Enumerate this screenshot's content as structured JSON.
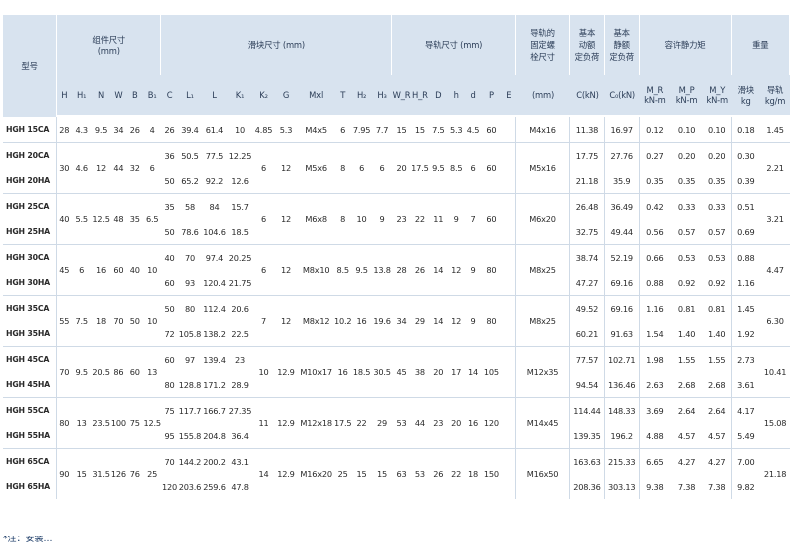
{
  "groups": {
    "model": "型号",
    "assembly": "组件尺寸\n(mm)",
    "block": "滑块尺寸 (mm)",
    "rail": "导轨尺寸 (mm)",
    "rail_bolt": "导轨的\n固定螺\n栓尺寸",
    "dyn_load": "基本\n动额\n定负荷",
    "stat_load": "基本\n静额\n定负荷",
    "moment": "容许静力矩",
    "weight": "重量"
  },
  "sub_headers": [
    "H",
    "H₁",
    "N",
    "W",
    "B",
    "B₁",
    "C",
    "L₁",
    "L",
    "K₁",
    "K₂",
    "G",
    "Mxl",
    "T",
    "H₂",
    "H₃",
    "W_R",
    "H_R",
    "D",
    "h",
    "d",
    "P",
    "E",
    "(mm)",
    "C(kN)",
    "C₀(kN)",
    "M_R\nkN-m",
    "M_P\nkN-m",
    "M_Y\nkN-m",
    "滑块\nkg",
    "导轨\nkg/m"
  ],
  "rows": [
    {
      "model": "HGH 15CA",
      "H": "28",
      "H1": "4.3",
      "N": "9.5",
      "W": "34",
      "B": "26",
      "B1": "4",
      "C": "26",
      "L1": "39.4",
      "L": "61.4",
      "K1": "10",
      "K2": "4.85",
      "G": "5.3",
      "Mxl": "M4x5",
      "T": "6",
      "H2": "7.95",
      "H3": "7.7",
      "WR": "15",
      "HR": "15",
      "D": "7.5",
      "h": "5.3",
      "d": "4.5",
      "P": "60",
      "E": "",
      "bolt": "M4x16",
      "C_kN": "11.38",
      "C0_kN": "16.97",
      "MR": "0.12",
      "MP": "0.10",
      "MY": "0.10",
      "block_kg": "0.18",
      "rail_kg": "1.45"
    },
    {
      "model": "HGH 20CA",
      "H": "30",
      "H1": "4.6",
      "N": "12",
      "W": "44",
      "B": "32",
      "B1": "6",
      "C": "36",
      "L1": "50.5",
      "L": "77.5",
      "K1": "12.25",
      "K2": "6",
      "G": "12",
      "Mxl": "M5x6",
      "T": "8",
      "H2": "6",
      "H3": "6",
      "WR": "20",
      "HR": "17.5",
      "D": "9.5",
      "h": "8.5",
      "d": "6",
      "P": "60",
      "E": "",
      "bolt": "M5x16",
      "C_kN": "17.75",
      "C0_kN": "27.76",
      "MR": "0.27",
      "MP": "0.20",
      "MY": "0.20",
      "block_kg": "0.30",
      "rail_kg": "2.21"
    },
    {
      "model": "HGH 20HA",
      "C": "50",
      "L1": "65.2",
      "L": "92.2",
      "K1": "12.6",
      "C_kN": "21.18",
      "C0_kN": "35.9",
      "MR": "0.35",
      "MP": "0.35",
      "MY": "0.35",
      "block_kg": "0.39"
    },
    {
      "model": "HGH 25CA",
      "H": "40",
      "H1": "5.5",
      "N": "12.5",
      "W": "48",
      "B": "35",
      "B1": "6.5",
      "C": "35",
      "L1": "58",
      "L": "84",
      "K1": "15.7",
      "K2": "6",
      "G": "12",
      "Mxl": "M6x8",
      "T": "8",
      "H2": "10",
      "H3": "9",
      "WR": "23",
      "HR": "22",
      "D": "11",
      "h": "9",
      "d": "7",
      "P": "60",
      "E": "",
      "bolt": "M6x20",
      "C_kN": "26.48",
      "C0_kN": "36.49",
      "MR": "0.42",
      "MP": "0.33",
      "MY": "0.33",
      "block_kg": "0.51",
      "rail_kg": "3.21"
    },
    {
      "model": "HGH 25HA",
      "C": "50",
      "L1": "78.6",
      "L": "104.6",
      "K1": "18.5",
      "C_kN": "32.75",
      "C0_kN": "49.44",
      "MR": "0.56",
      "MP": "0.57",
      "MY": "0.57",
      "block_kg": "0.69"
    },
    {
      "model": "HGH 30CA",
      "H": "45",
      "H1": "6",
      "N": "16",
      "W": "60",
      "B": "40",
      "B1": "10",
      "C": "40",
      "L1": "70",
      "L": "97.4",
      "K1": "20.25",
      "K2": "6",
      "G": "12",
      "Mxl": "M8x10",
      "T": "8.5",
      "H2": "9.5",
      "H3": "13.8",
      "WR": "28",
      "HR": "26",
      "D": "14",
      "h": "12",
      "d": "9",
      "P": "80",
      "E": "",
      "bolt": "M8x25",
      "C_kN": "38.74",
      "C0_kN": "52.19",
      "MR": "0.66",
      "MP": "0.53",
      "MY": "0.53",
      "block_kg": "0.88",
      "rail_kg": "4.47"
    },
    {
      "model": "HGH 30HA",
      "C": "60",
      "L1": "93",
      "L": "120.4",
      "K1": "21.75",
      "C_kN": "47.27",
      "C0_kN": "69.16",
      "MR": "0.88",
      "MP": "0.92",
      "MY": "0.92",
      "block_kg": "1.16"
    },
    {
      "model": "HGH 35CA",
      "H": "55",
      "H1": "7.5",
      "N": "18",
      "W": "70",
      "B": "50",
      "B1": "10",
      "C": "50",
      "L1": "80",
      "L": "112.4",
      "K1": "20.6",
      "K2": "7",
      "G": "12",
      "Mxl": "M8x12",
      "T": "10.2",
      "H2": "16",
      "H3": "19.6",
      "WR": "34",
      "HR": "29",
      "D": "14",
      "h": "12",
      "d": "9",
      "P": "80",
      "E": "",
      "bolt": "M8x25",
      "C_kN": "49.52",
      "C0_kN": "69.16",
      "MR": "1.16",
      "MP": "0.81",
      "MY": "0.81",
      "block_kg": "1.45",
      "rail_kg": "6.30"
    },
    {
      "model": "HGH 35HA",
      "C": "72",
      "L1": "105.8",
      "L": "138.2",
      "K1": "22.5",
      "C_kN": "60.21",
      "C0_kN": "91.63",
      "MR": "1.54",
      "MP": "1.40",
      "MY": "1.40",
      "block_kg": "1.92"
    },
    {
      "model": "HGH 45CA",
      "H": "70",
      "H1": "9.5",
      "N": "20.5",
      "W": "86",
      "B": "60",
      "B1": "13",
      "C": "60",
      "L1": "97",
      "L": "139.4",
      "K1": "23",
      "K2": "10",
      "G": "12.9",
      "Mxl": "M10x17",
      "T": "16",
      "H2": "18.5",
      "H3": "30.5",
      "WR": "45",
      "HR": "38",
      "D": "20",
      "h": "17",
      "d": "14",
      "P": "105",
      "E": "",
      "bolt": "M12x35",
      "C_kN": "77.57",
      "C0_kN": "102.71",
      "MR": "1.98",
      "MP": "1.55",
      "MY": "1.55",
      "block_kg": "2.73",
      "rail_kg": "10.41"
    },
    {
      "model": "HGH 45HA",
      "C": "80",
      "L1": "128.8",
      "L": "171.2",
      "K1": "28.9",
      "C_kN": "94.54",
      "C0_kN": "136.46",
      "MR": "2.63",
      "MP": "2.68",
      "MY": "2.68",
      "block_kg": "3.61"
    },
    {
      "model": "HGH 55CA",
      "H": "80",
      "H1": "13",
      "N": "23.5",
      "W": "100",
      "B": "75",
      "B1": "12.5",
      "C": "75",
      "L1": "117.7",
      "L": "166.7",
      "K1": "27.35",
      "K2": "11",
      "G": "12.9",
      "Mxl": "M12x18",
      "T": "17.5",
      "H2": "22",
      "H3": "29",
      "WR": "53",
      "HR": "44",
      "D": "23",
      "h": "20",
      "d": "16",
      "P": "120",
      "E": "",
      "bolt": "M14x45",
      "C_kN": "114.44",
      "C0_kN": "148.33",
      "MR": "3.69",
      "MP": "2.64",
      "MY": "2.64",
      "block_kg": "4.17",
      "rail_kg": "15.08"
    },
    {
      "model": "HGH 55HA",
      "C": "95",
      "L1": "155.8",
      "L": "204.8",
      "K1": "36.4",
      "C_kN": "139.35",
      "C0_kN": "196.2",
      "MR": "4.88",
      "MP": "4.57",
      "MY": "4.57",
      "block_kg": "5.49"
    },
    {
      "model": "HGH 65CA",
      "H": "90",
      "H1": "15",
      "N": "31.5",
      "W": "126",
      "B": "76",
      "B1": "25",
      "C": "70",
      "L1": "144.2",
      "L": "200.2",
      "K1": "43.1",
      "K2": "14",
      "G": "12.9",
      "Mxl": "M16x20",
      "T": "25",
      "H2": "15",
      "H3": "15",
      "WR": "63",
      "HR": "53",
      "D": "26",
      "h": "22",
      "d": "18",
      "P": "150",
      "E": "",
      "bolt": "M16x50",
      "C_kN": "163.63",
      "C0_kN": "215.33",
      "MR": "6.65",
      "MP": "4.27",
      "MY": "4.27",
      "block_kg": "7.00",
      "rail_kg": "21.18"
    },
    {
      "model": "HGH 65HA",
      "C": "120",
      "L1": "203.6",
      "L": "259.6",
      "K1": "47.8",
      "C_kN": "208.36",
      "C0_kN": "303.13",
      "MR": "9.38",
      "MP": "7.38",
      "MY": "7.38",
      "block_kg": "9.82"
    }
  ],
  "footer_fragment": "*注：安装…"
}
